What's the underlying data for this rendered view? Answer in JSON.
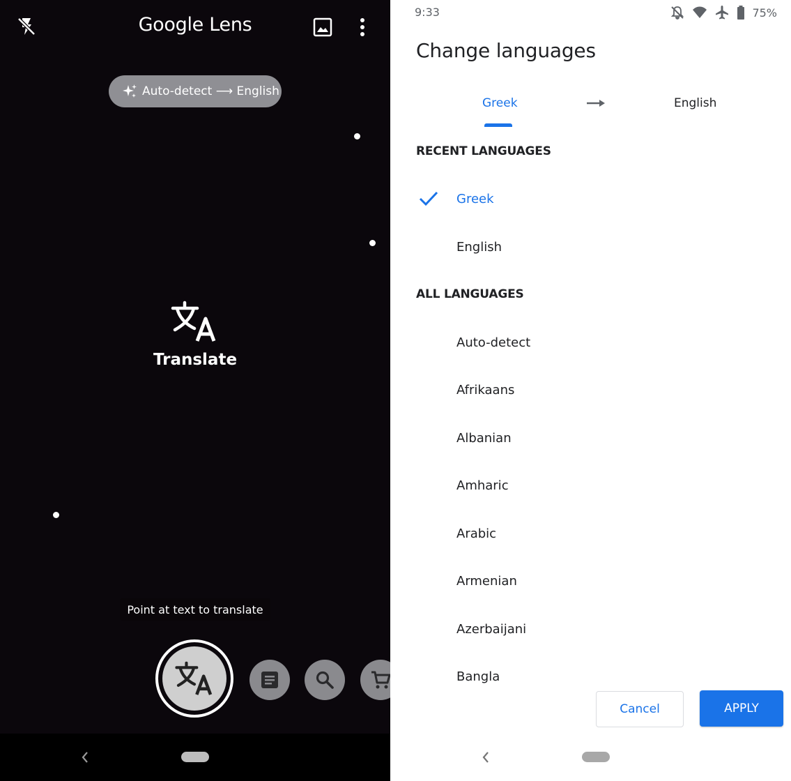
{
  "lens": {
    "app_title": "Google Lens",
    "language_pill": "Auto-detect ⟶ English",
    "mode_label": "Translate",
    "hint": "Point at text to translate",
    "icons": {
      "flash": "flash-off-icon",
      "gallery": "image-icon",
      "more": "more-vert-icon",
      "sparkle": "sparkle-icon",
      "translate": "translate-icon",
      "text": "text-document-icon",
      "search": "search-icon",
      "shopping": "shopping-cart-icon"
    }
  },
  "picker": {
    "status": {
      "time": "9:33",
      "battery": "75%"
    },
    "title": "Change languages",
    "from_language": "Greek",
    "to_language": "English",
    "recent_header": "RECENT LANGUAGES",
    "recent": [
      {
        "label": "Greek",
        "selected": true
      },
      {
        "label": "English",
        "selected": false
      }
    ],
    "all_header": "ALL LANGUAGES",
    "all": [
      "Auto-detect",
      "Afrikaans",
      "Albanian",
      "Amharic",
      "Arabic",
      "Armenian",
      "Azerbaijani",
      "Bangla"
    ],
    "cancel_label": "Cancel",
    "apply_label": "APPLY"
  },
  "colors": {
    "accent": "#1a73e8",
    "camera_background": "#0b070c",
    "pill": "#8f8f94",
    "text_primary": "#202124"
  }
}
